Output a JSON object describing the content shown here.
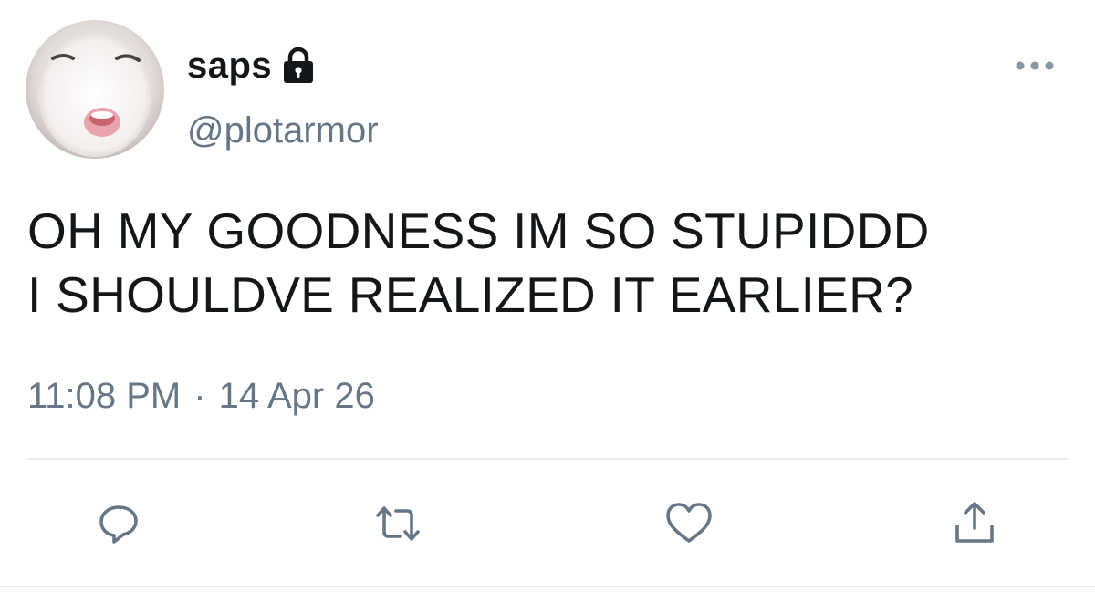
{
  "tweet": {
    "display_name": "saps",
    "handle": "@plotarmor",
    "protected_icon": "lock-icon",
    "text": "OH MY GOODNESS IM SO STUPIDDD\nI SHOULDVE REALIZED IT EARLIER?",
    "time": "11:08 PM",
    "separator": "·",
    "date": "14 Apr 26"
  },
  "actions": [
    {
      "icon": "reply-icon"
    },
    {
      "icon": "retweet-icon"
    },
    {
      "icon": "like-icon"
    },
    {
      "icon": "share-icon"
    }
  ],
  "colors": {
    "text": "#14171a",
    "secondary": "#657786",
    "divider": "#e6ecf0"
  }
}
